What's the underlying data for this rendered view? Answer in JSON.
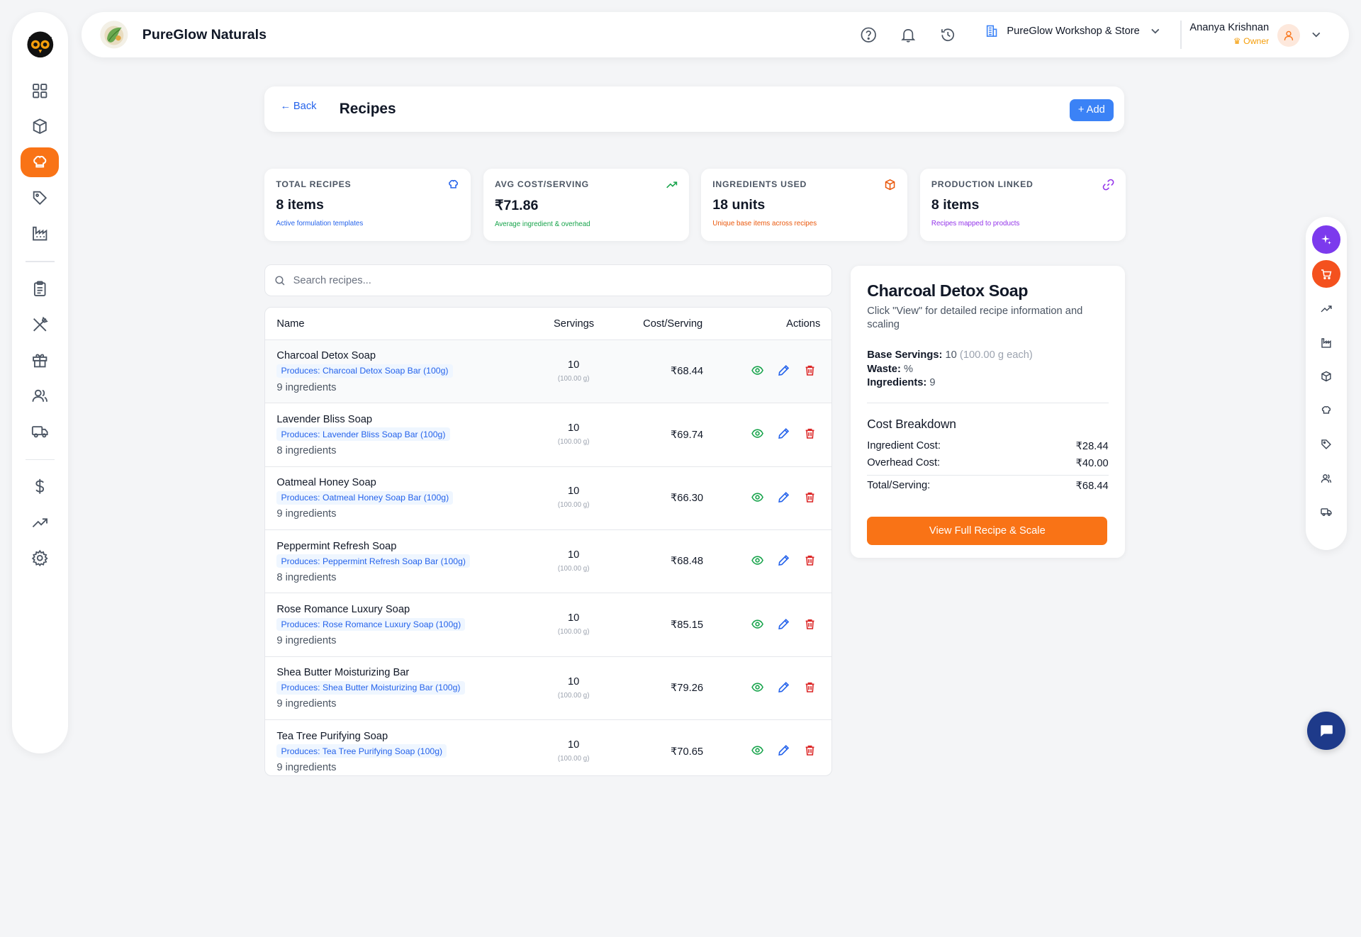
{
  "app": {
    "brand": "PureGlow Naturals"
  },
  "topbar": {
    "workspace": "PureGlow Workshop & Store",
    "user_name": "Ananya Krishnan",
    "user_role": "Owner"
  },
  "page": {
    "back_label": "Back",
    "title": "Recipes",
    "add_label": "+ Add"
  },
  "stats": [
    {
      "label": "TOTAL RECIPES",
      "value": "8 items",
      "sub": "Active formulation templates",
      "color": "#2563eb",
      "icon": "chef-hat-icon"
    },
    {
      "label": "AVG COST/SERVING",
      "value": "₹71.86",
      "sub": "Average ingredient & overhead",
      "color": "#16a34a",
      "icon": "trend-up-icon"
    },
    {
      "label": "INGREDIENTS USED",
      "value": "18 units",
      "sub": "Unique base items across recipes",
      "color": "#ea580c",
      "icon": "box-icon"
    },
    {
      "label": "PRODUCTION LINKED",
      "value": "8 items",
      "sub": "Recipes mapped to products",
      "color": "#9333ea",
      "icon": "link-icon"
    }
  ],
  "search": {
    "placeholder": "Search recipes..."
  },
  "table": {
    "headers": {
      "name": "Name",
      "servings": "Servings",
      "cost": "Cost/Serving",
      "actions": "Actions"
    },
    "rows": [
      {
        "name": "Charcoal Detox Soap",
        "produces": "Produces: Charcoal Detox Soap Bar (100g)",
        "ingredients": "9 ingredients",
        "servings": "10",
        "serving_size": "(100.00 g)",
        "cost": "₹68.44"
      },
      {
        "name": "Lavender Bliss Soap",
        "produces": "Produces: Lavender Bliss Soap Bar (100g)",
        "ingredients": "8 ingredients",
        "servings": "10",
        "serving_size": "(100.00 g)",
        "cost": "₹69.74"
      },
      {
        "name": "Oatmeal Honey Soap",
        "produces": "Produces: Oatmeal Honey Soap Bar (100g)",
        "ingredients": "9 ingredients",
        "servings": "10",
        "serving_size": "(100.00 g)",
        "cost": "₹66.30"
      },
      {
        "name": "Peppermint Refresh Soap",
        "produces": "Produces: Peppermint Refresh Soap Bar (100g)",
        "ingredients": "8 ingredients",
        "servings": "10",
        "serving_size": "(100.00 g)",
        "cost": "₹68.48"
      },
      {
        "name": "Rose Romance Luxury Soap",
        "produces": "Produces: Rose Romance Luxury Soap (100g)",
        "ingredients": "9 ingredients",
        "servings": "10",
        "serving_size": "(100.00 g)",
        "cost": "₹85.15"
      },
      {
        "name": "Shea Butter Moisturizing Bar",
        "produces": "Produces: Shea Butter Moisturizing Bar (100g)",
        "ingredients": "9 ingredients",
        "servings": "10",
        "serving_size": "(100.00 g)",
        "cost": "₹79.26"
      },
      {
        "name": "Tea Tree Purifying Soap",
        "produces": "Produces: Tea Tree Purifying Soap (100g)",
        "ingredients": "9 ingredients",
        "servings": "10",
        "serving_size": "(100.00 g)",
        "cost": "₹70.65"
      }
    ]
  },
  "detail": {
    "title": "Charcoal Detox Soap",
    "description": "Click \"View\" for detailed recipe information and scaling",
    "base_servings_label": "Base Servings:",
    "base_servings_value": "10",
    "base_servings_unit": "(100.00 g each)",
    "waste_label": "Waste:",
    "waste_value": "%",
    "ingredients_label": "Ingredients:",
    "ingredients_value": "9",
    "breakdown_title": "Cost Breakdown",
    "ingredient_cost_label": "Ingredient Cost:",
    "ingredient_cost": "₹28.44",
    "overhead_cost_label": "Overhead Cost:",
    "overhead_cost": "₹40.00",
    "total_label": "Total/Serving:",
    "total": "₹68.44",
    "button": "View Full Recipe & Scale"
  },
  "colors": {
    "accent": "#f97316",
    "primary": "#3b82f6",
    "rail_ai": "#7c3aed",
    "rail_cart": "#f4511e",
    "chat": "#1e3a8a"
  }
}
